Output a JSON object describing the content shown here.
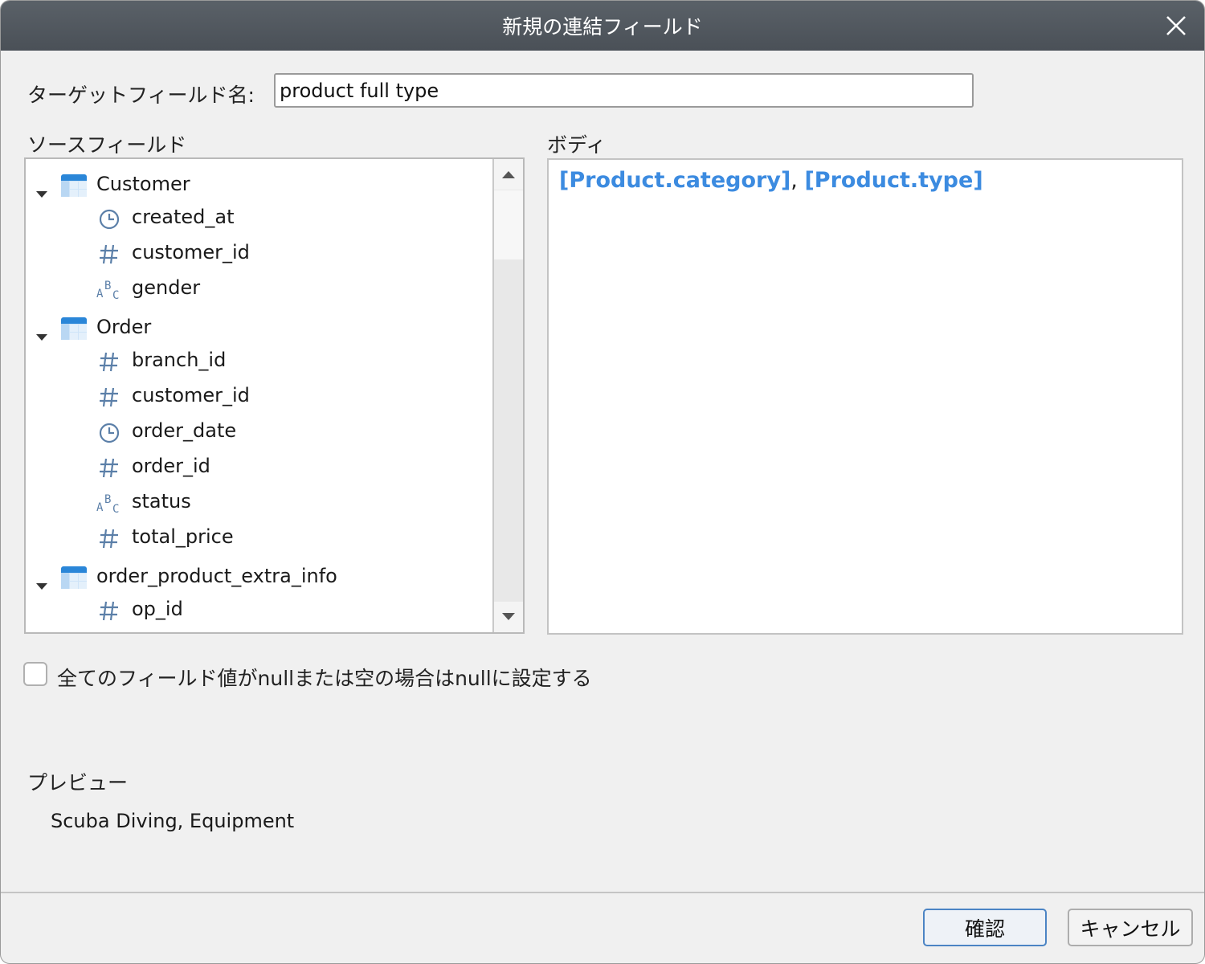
{
  "window": {
    "title": "新規の連結フィールド"
  },
  "target": {
    "label": "ターゲットフィールド名:",
    "value": "product full type"
  },
  "source": {
    "label": "ソースフィールド",
    "tree": [
      {
        "kind": "group",
        "label": "Customer"
      },
      {
        "kind": "field",
        "type": "clock",
        "label": "created_at"
      },
      {
        "kind": "field",
        "type": "number",
        "label": "customer_id"
      },
      {
        "kind": "field",
        "type": "text",
        "label": "gender"
      },
      {
        "kind": "group",
        "label": "Order"
      },
      {
        "kind": "field",
        "type": "number",
        "label": "branch_id"
      },
      {
        "kind": "field",
        "type": "number",
        "label": "customer_id"
      },
      {
        "kind": "field",
        "type": "clock",
        "label": "order_date"
      },
      {
        "kind": "field",
        "type": "number",
        "label": "order_id"
      },
      {
        "kind": "field",
        "type": "text",
        "label": "status"
      },
      {
        "kind": "field",
        "type": "number",
        "label": "total_price"
      },
      {
        "kind": "group",
        "label": "order_product_extra_info"
      },
      {
        "kind": "field",
        "type": "number",
        "label": "op_id"
      }
    ]
  },
  "body": {
    "label": "ボディ",
    "token1": "[Product.category]",
    "separator": ", ",
    "token2": "[Product.type]"
  },
  "null_option": {
    "label": "全てのフィールド値がnullまたは空の場合はnullに設定する",
    "checked": false
  },
  "preview": {
    "label": "プレビュー",
    "value": "Scuba Diving, Equipment"
  },
  "buttons": {
    "ok": "確認",
    "cancel": "キャンセル"
  },
  "colors": {
    "token": "#3c8be0",
    "titlebar": "#4f555c",
    "table_icon": "#2a86d8"
  }
}
